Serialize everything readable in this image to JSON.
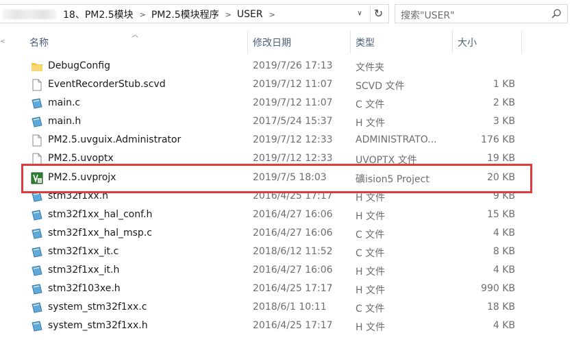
{
  "address": {
    "crumbs": [
      "18、PM2.5模块",
      "PM2.5模块程序",
      "USER"
    ],
    "separator": ">",
    "dropdown_glyph": "∨",
    "refresh_glyph": "↻"
  },
  "search": {
    "placeholder": "搜索\"USER\""
  },
  "columns": {
    "name": "名称",
    "date": "修改日期",
    "type": "类型",
    "size": "大小"
  },
  "files": [
    {
      "name": "DebugConfig",
      "date": "2019/7/26 17:13",
      "type": "文件夹",
      "size": "",
      "icon": "folder-icon"
    },
    {
      "name": "EventRecorderStub.scvd",
      "date": "2019/7/12 11:07",
      "type": "SCVD 文件",
      "size": "1 KB",
      "icon": "file-icon"
    },
    {
      "name": "main.c",
      "date": "2019/7/12 11:07",
      "type": "C 文件",
      "size": "2 KB",
      "icon": "source-file-icon"
    },
    {
      "name": "main.h",
      "date": "2017/5/24 15:37",
      "type": "H 文件",
      "size": "3 KB",
      "icon": "source-file-icon"
    },
    {
      "name": "PM2.5.uvguix.Administrator",
      "date": "2019/7/12 12:33",
      "type": "ADMINISTRATO...",
      "size": "176 KB",
      "icon": "file-icon"
    },
    {
      "name": "PM2.5.uvoptx",
      "date": "2019/7/12 12:33",
      "type": "UVOPTX 文件",
      "size": "19 KB",
      "icon": "file-icon"
    },
    {
      "name": "PM2.5.uvprojx",
      "date": "2019/7/5 18:03",
      "type": "礦ision5 Project",
      "size": "20 KB",
      "icon": "keil-project-icon"
    },
    {
      "name": "stm32f1xx.h",
      "date": "2016/4/25 17:17",
      "type": "H 文件",
      "size": "9 KB",
      "icon": "source-file-icon"
    },
    {
      "name": "stm32f1xx_hal_conf.h",
      "date": "2016/4/27 16:06",
      "type": "H 文件",
      "size": "15 KB",
      "icon": "source-file-icon"
    },
    {
      "name": "stm32f1xx_hal_msp.c",
      "date": "2016/4/27 16:06",
      "type": "C 文件",
      "size": "4 KB",
      "icon": "source-file-icon"
    },
    {
      "name": "stm32f1xx_it.c",
      "date": "2018/6/12 11:52",
      "type": "C 文件",
      "size": "8 KB",
      "icon": "source-file-icon"
    },
    {
      "name": "stm32f1xx_it.h",
      "date": "2016/4/27 16:06",
      "type": "H 文件",
      "size": "4 KB",
      "icon": "source-file-icon"
    },
    {
      "name": "stm32f103xe.h",
      "date": "2016/4/25 17:17",
      "type": "H 文件",
      "size": "990 KB",
      "icon": "source-file-icon"
    },
    {
      "name": "system_stm32f1xx.c",
      "date": "2018/6/1 10:11",
      "type": "C 文件",
      "size": "18 KB",
      "icon": "source-file-icon"
    },
    {
      "name": "system_stm32f1xx.h",
      "date": "2016/4/25 17:17",
      "type": "H 文件",
      "size": "4 KB",
      "icon": "source-file-icon"
    }
  ],
  "highlight_color": "#e23a3a"
}
